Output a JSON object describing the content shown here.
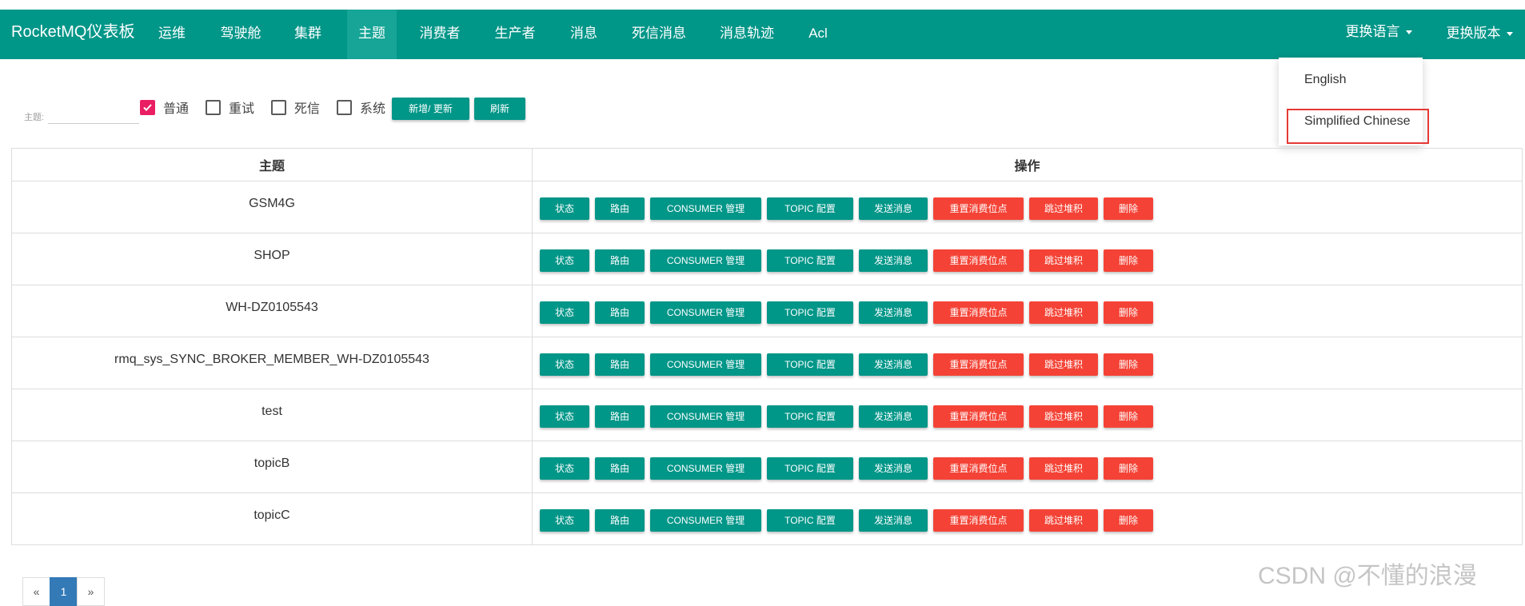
{
  "navbar": {
    "brand": "RocketMQ仪表板",
    "items": [
      "运维",
      "驾驶舱",
      "集群",
      "主题",
      "消费者",
      "生产者",
      "消息",
      "死信消息",
      "消息轨迹",
      "Acl"
    ],
    "active_item": "主题",
    "language_menu": "更换语言",
    "version_menu": "更换版本"
  },
  "language_dropdown": {
    "options": [
      "English",
      "Simplified Chinese"
    ],
    "highlighted": "Simplified Chinese"
  },
  "filter": {
    "topic_label": "主题:",
    "topic_value": "",
    "checkboxes": [
      {
        "label": "普通",
        "checked": true
      },
      {
        "label": "重试",
        "checked": false
      },
      {
        "label": "死信",
        "checked": false
      },
      {
        "label": "系统",
        "checked": false
      }
    ],
    "add_update_label": "新增/ 更新",
    "refresh_label": "刷新"
  },
  "table": {
    "headers": [
      "主题",
      "操作"
    ],
    "actions": [
      {
        "label": "状态",
        "style": "teal"
      },
      {
        "label": "路由",
        "style": "teal"
      },
      {
        "label": "CONSUMER 管理",
        "style": "teal"
      },
      {
        "label": "TOPIC 配置",
        "style": "teal"
      },
      {
        "label": "发送消息",
        "style": "teal"
      },
      {
        "label": "重置消费位点",
        "style": "red"
      },
      {
        "label": "跳过堆积",
        "style": "red"
      },
      {
        "label": "删除",
        "style": "red"
      }
    ],
    "rows": [
      "GSM4G",
      "SHOP",
      "WH-DZ0105543",
      "rmq_sys_SYNC_BROKER_MEMBER_WH-DZ0105543",
      "test",
      "topicB",
      "topicC"
    ]
  },
  "pagination": {
    "prev": "«",
    "pages": [
      "1"
    ],
    "current": "1",
    "next": "»"
  },
  "watermark": "CSDN @不懂的浪漫",
  "colors": {
    "primary": "#009688",
    "danger": "#f44336",
    "checkbox": "#e91e63",
    "highlight": "#e53935",
    "page_active": "#337ab7"
  }
}
